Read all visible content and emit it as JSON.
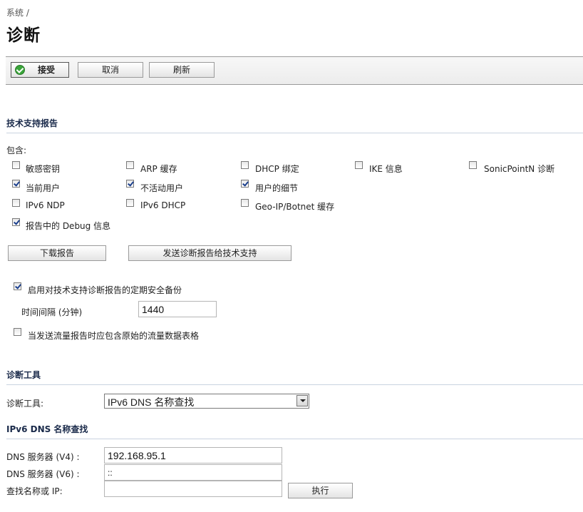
{
  "breadcrumb": "系统 /",
  "page_title": "诊断",
  "toolbar": {
    "accept": "接受",
    "cancel": "取消",
    "refresh": "刷新"
  },
  "tech_support": {
    "heading": "技术支持报告",
    "include_label": "包含:",
    "options": [
      {
        "label": "敏感密钥",
        "checked": false
      },
      {
        "label": "ARP 缓存",
        "checked": false
      },
      {
        "label": "DHCP 绑定",
        "checked": false
      },
      {
        "label": "IKE 信息",
        "checked": false
      },
      {
        "label": "SonicPointN 诊断",
        "checked": false
      },
      {
        "label": "当前用户",
        "checked": true
      },
      {
        "label": "不活动用户",
        "checked": true
      },
      {
        "label": "用户的细节",
        "checked": true
      },
      {
        "label": "IPv6 NDP",
        "checked": false
      },
      {
        "label": "IPv6 DHCP",
        "checked": false
      },
      {
        "label": "Geo-IP/Botnet 缓存",
        "checked": false
      },
      {
        "label": "报告中的 Debug 信息",
        "checked": true
      }
    ],
    "download_button": "下载报告",
    "send_button": "发送诊断报告给技术支持",
    "periodic_backup": {
      "label": "启用对技术支持诊断报告的定期安全备份",
      "checked": true
    },
    "interval_label": "时间间隔 (分钟)",
    "interval_value": "1440",
    "raw_flow": {
      "label": "当发送流量报告时应包含原始的流量数据表格",
      "checked": false
    }
  },
  "diag_tools": {
    "heading": "诊断工具",
    "tool_label": "诊断工具:",
    "tool_selected": "IPv6 DNS 名称查找"
  },
  "dns_lookup": {
    "heading": "IPv6 DNS 名称查找",
    "v4_label": "DNS 服务器 (V4) :",
    "v4_value": "192.168.95.1",
    "v6_label": "DNS 服务器 (V6) :",
    "v6_value": "::",
    "lookup_label": "查找名称或 IP:",
    "lookup_value": "",
    "execute_button": "执行"
  }
}
